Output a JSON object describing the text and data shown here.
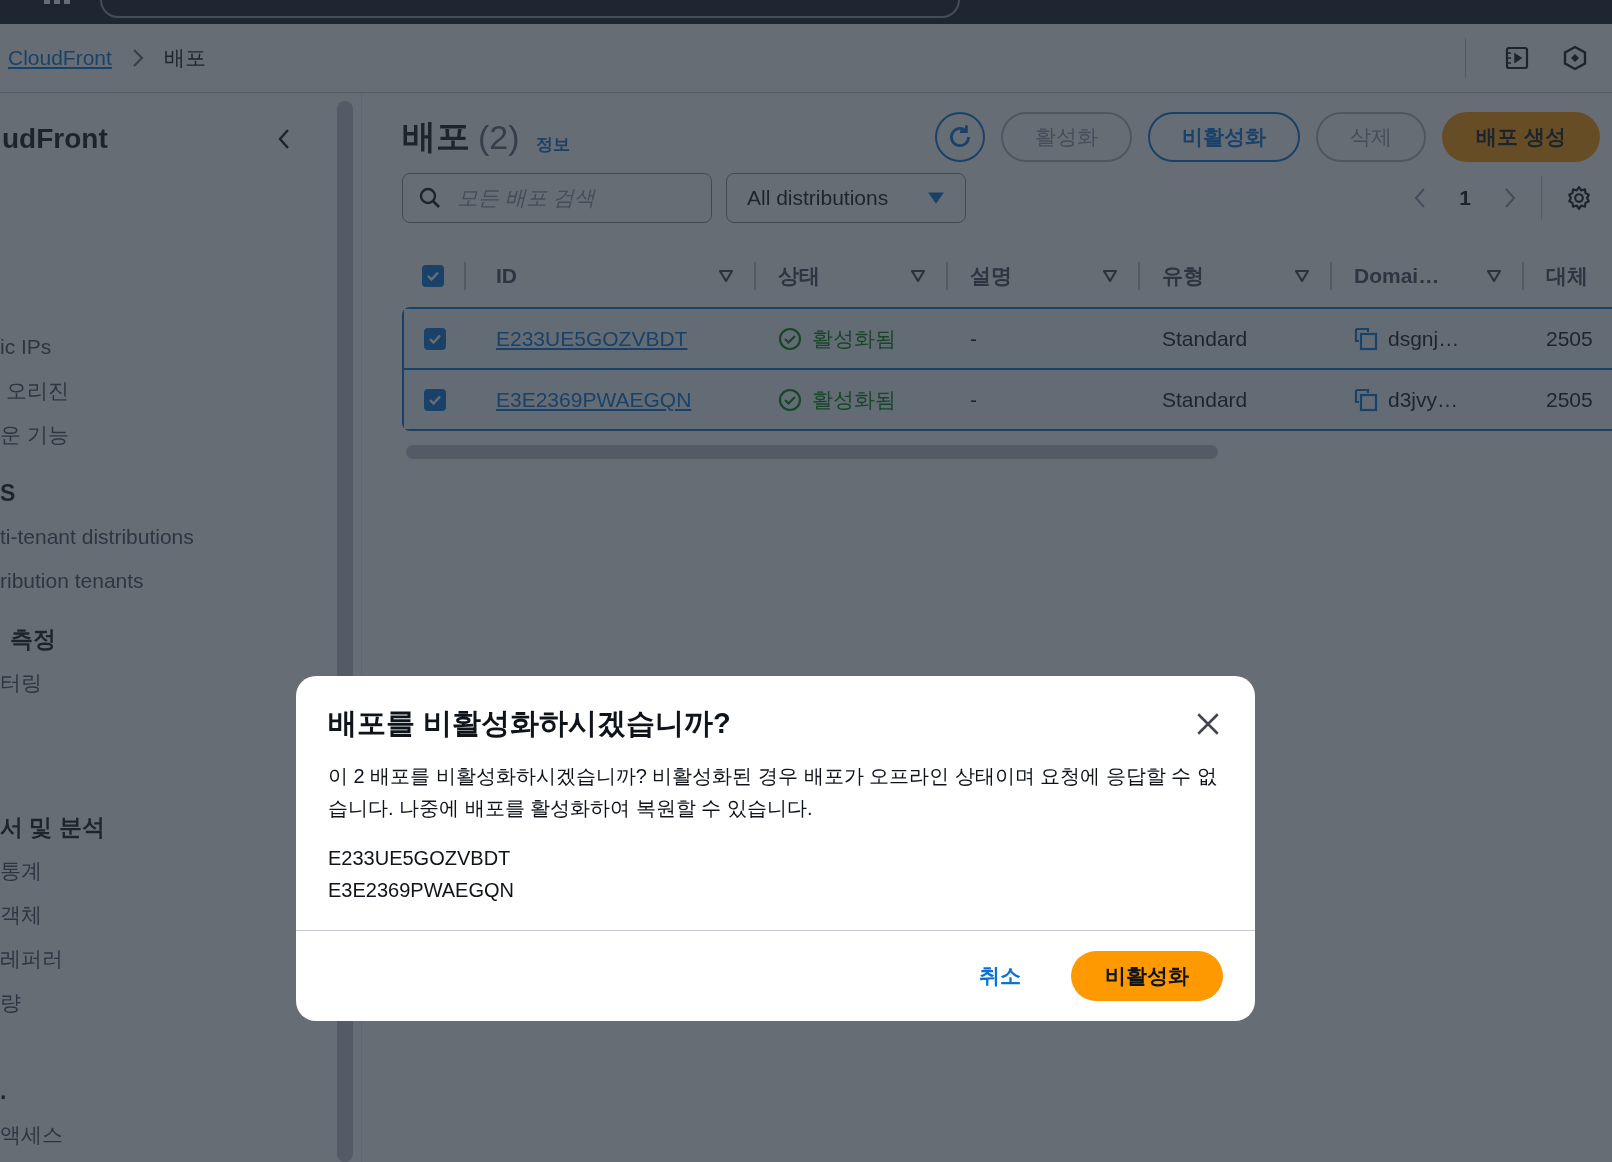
{
  "breadcrumb": [
    {
      "label": "CloudFront",
      "link": true
    },
    {
      "label": "배포",
      "link": false
    }
  ],
  "sidebar": {
    "title": "udFront",
    "items": [
      {
        "label": "ic IPs",
        "kind": "link"
      },
      {
        "label": "오리진",
        "kind": "link"
      },
      {
        "label": "운 기능",
        "kind": "link"
      },
      {
        "label": "S",
        "kind": "heading"
      },
      {
        "label": "ti-tenant distributions",
        "kind": "link"
      },
      {
        "label": "ribution tenants",
        "kind": "link"
      },
      {
        "label": "측정",
        "kind": "heading"
      },
      {
        "label": "터링",
        "kind": "link"
      },
      {
        "label": "서 및 분석",
        "kind": "heading"
      },
      {
        "label": "통계",
        "kind": "link"
      },
      {
        "label": "객체",
        "kind": "link"
      },
      {
        "label": "레퍼러",
        "kind": "link"
      },
      {
        "label": "량",
        "kind": "link"
      },
      {
        "label": ".",
        "kind": "heading"
      },
      {
        "label": "액세스",
        "kind": "link"
      }
    ]
  },
  "header": {
    "title": "배포",
    "count": "(2)",
    "info": "정보"
  },
  "buttons": [
    {
      "label": "활성화",
      "kind": "normal",
      "disabled": true
    },
    {
      "label": "비활성화",
      "kind": "normal",
      "disabled": false
    },
    {
      "label": "삭제",
      "kind": "normal",
      "disabled": true
    },
    {
      "label": "배포 생성",
      "kind": "primary",
      "disabled": false
    }
  ],
  "search": {
    "placeholder": "모든 배포 검색"
  },
  "filter": {
    "value": "All distributions"
  },
  "pagination": {
    "page": "1"
  },
  "table": {
    "all_selected": true,
    "columns": [
      "ID",
      "상태",
      "설명",
      "유형",
      "Domai…",
      "대체"
    ],
    "rows": [
      {
        "selected": true,
        "id": "E233UE5GOZVBDT",
        "status": "활성화됨",
        "description": "-",
        "type": "Standard",
        "domain": "dsgnj…",
        "column_6": "2505"
      },
      {
        "selected": true,
        "id": "E3E2369PWAEGQN",
        "status": "활성화됨",
        "description": "-",
        "type": "Standard",
        "domain": "d3jvy…",
        "column_6": "2505"
      }
    ]
  },
  "dialog": {
    "title": "배포를 비활성화하시겠습니까?",
    "message": "이 2 배포를 비활성화하시겠습니까? 비활성화된 경우 배포가 오프라인 상태이며 요청에 응답할 수 없습니다. 나중에 배포를 활성화하여 복원할 수 있습니다.",
    "items": [
      "E233UE5GOZVBDT",
      "E3E2369PWAEGQN"
    ],
    "cancel": "취소",
    "confirm": "비활성화"
  }
}
